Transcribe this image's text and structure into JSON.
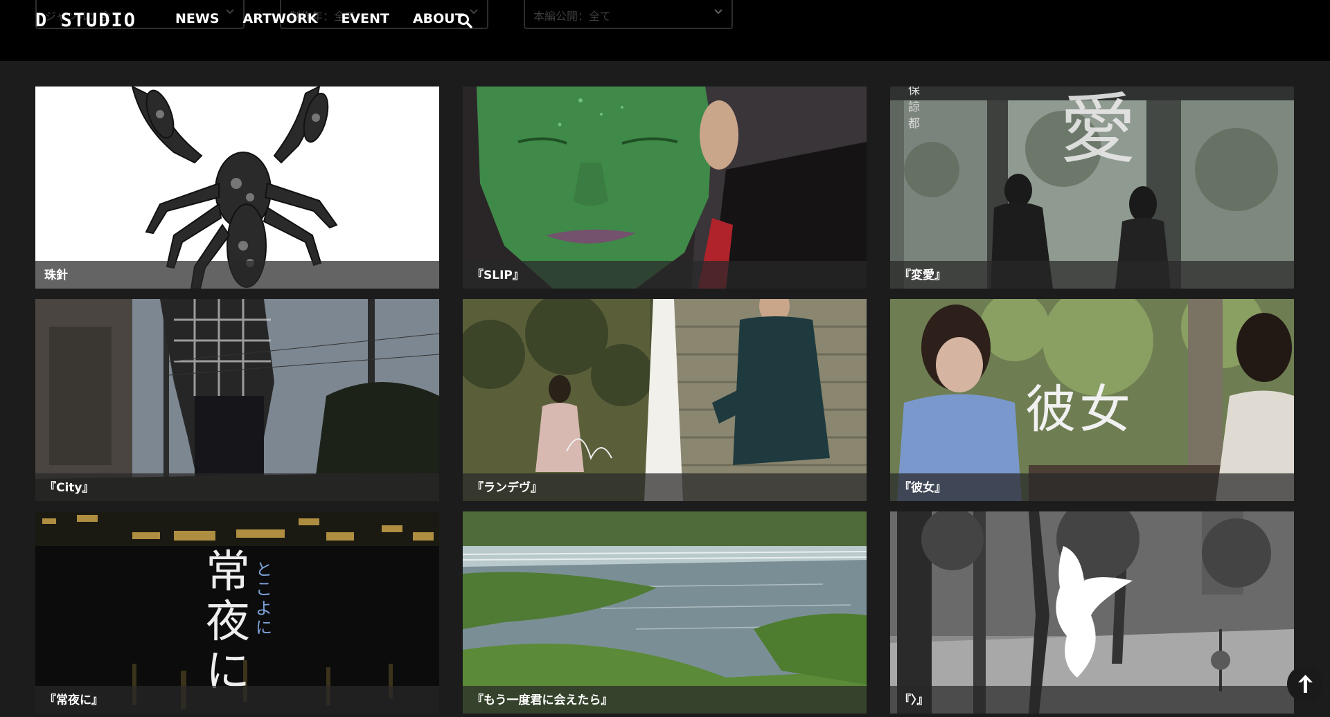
{
  "header": {
    "logo": "D STUDIO",
    "nav": [
      "NEWS",
      "ARTWORK",
      "EVENT",
      "ABOUT"
    ],
    "search_icon": "search-icon",
    "filters": [
      {
        "label": "ジャンル：全て"
      },
      {
        "label": "制作年：全て"
      },
      {
        "label": "本編公開：全て"
      }
    ]
  },
  "works": [
    {
      "title": "珠針",
      "thumb": "scorpion-illustration"
    },
    {
      "title": "『SLIP』",
      "thumb": "green-face"
    },
    {
      "title": "『変愛』",
      "thumb": "two-figures-window"
    },
    {
      "title": "『City』",
      "thumb": "man-back-sky"
    },
    {
      "title": "『ランデヴ』",
      "thumb": "woman-and-man-pillar"
    },
    {
      "title": "『彼女』",
      "thumb": "two-women-trees"
    },
    {
      "title": "『常夜に』",
      "thumb": "night-city-title"
    },
    {
      "title": "『もう一度君に会えたら』",
      "thumb": "river-weir"
    },
    {
      "title": "『〉』",
      "thumb": "white-brush-trees"
    }
  ],
  "thumb_text": {
    "kanji_ai": "愛",
    "cast_vertical": "保\n諒\n都",
    "kanojo": "彼女",
    "toko": "常夜に",
    "tokoyoni_kana": "とこよに"
  },
  "back_to_top_icon": "arrow-up-icon",
  "colors": {
    "header_bg": "#000000",
    "page_bg": "#1c1c1c",
    "caption_bar": "rgba(40,40,40,0.72)"
  }
}
